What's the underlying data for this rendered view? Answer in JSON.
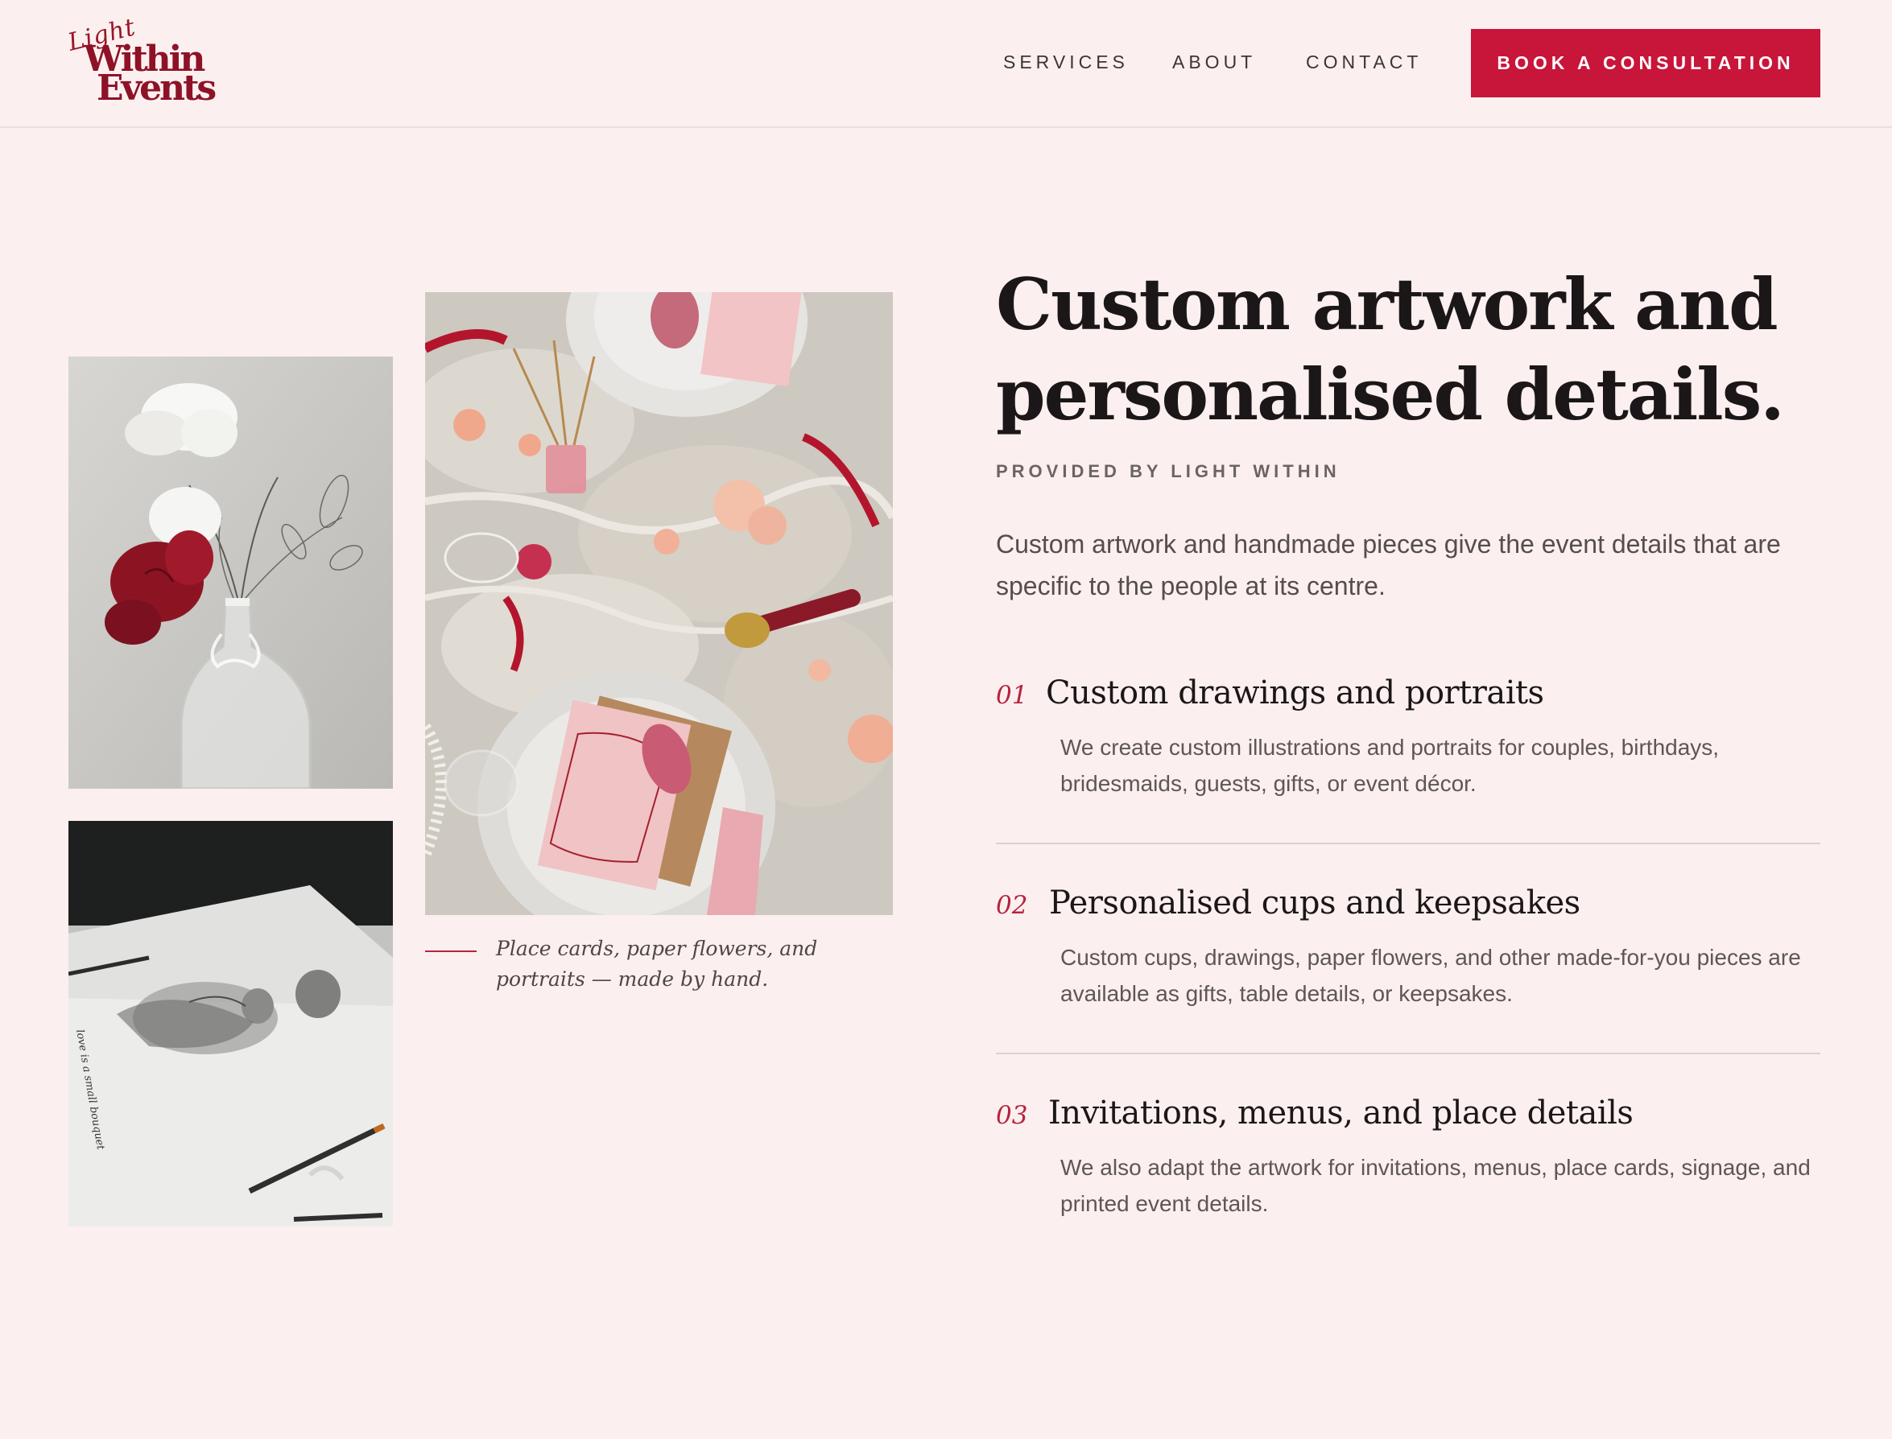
{
  "brand": {
    "logo_script": "Light",
    "logo_line1": "Within",
    "logo_line2": "Events",
    "accent_color": "#c8153a",
    "logo_color": "#8d1228",
    "background_color": "#fbf0ef"
  },
  "nav": {
    "items": [
      {
        "label": "SERVICES"
      },
      {
        "label": "ABOUT"
      },
      {
        "label": "CONTACT"
      }
    ],
    "cta_label": "BOOK A CONSULTATION"
  },
  "gallery": {
    "caption": "Place cards, paper flowers, and portraits — made by hand."
  },
  "section": {
    "headline_line1": "Custom artwork and",
    "headline_line2": "personalised details.",
    "eyebrow": "PROVIDED BY LIGHT WITHIN",
    "intro": "Custom artwork and handmade pieces give the event details that are specific to the people at its centre.",
    "items": [
      {
        "number": "01",
        "title": "Custom drawings and portraits",
        "description": "We create custom illustrations and portraits for couples, birthdays, bridesmaids, guests, gifts, or event décor."
      },
      {
        "number": "02",
        "title": "Personalised cups and keepsakes",
        "description": "Custom cups, drawings, paper flowers, and other made-for-you pieces are available as gifts, table details, or keepsakes."
      },
      {
        "number": "03",
        "title": "Invitations, menus, and place details",
        "description": "We also adapt the artwork for invitations, menus, place cards, signage, and printed event details."
      }
    ]
  }
}
